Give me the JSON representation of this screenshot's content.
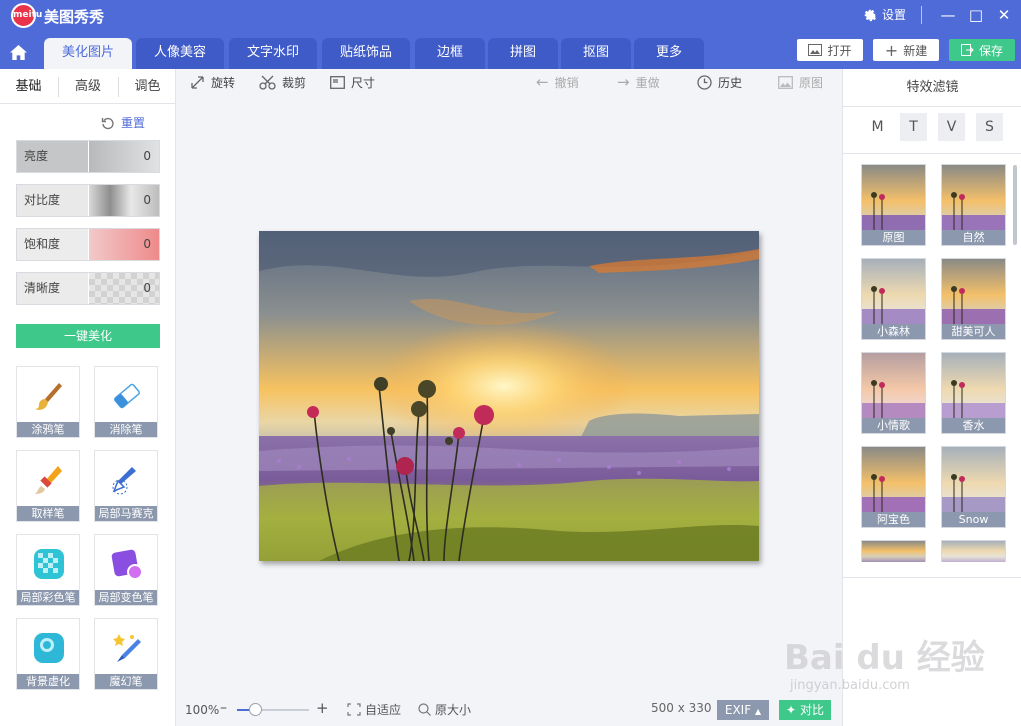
{
  "app": {
    "title": "美图秀秀",
    "logo_text": "meitu"
  },
  "window": {
    "settings_label": "设置"
  },
  "tabs": [
    {
      "label": "美化图片",
      "active": true
    },
    {
      "label": "人像美容"
    },
    {
      "label": "文字水印"
    },
    {
      "label": "贴纸饰品"
    },
    {
      "label": "边框"
    },
    {
      "label": "拼图"
    },
    {
      "label": "抠图"
    },
    {
      "label": "更多"
    }
  ],
  "actions": {
    "open": "打开",
    "new": "新建",
    "save": "保存"
  },
  "left": {
    "subtabs": [
      "基础",
      "高级",
      "调色"
    ],
    "reset_label": "重置",
    "sliders": [
      {
        "label": "亮度",
        "value": "0"
      },
      {
        "label": "对比度",
        "value": "0"
      },
      {
        "label": "饱和度",
        "value": "0"
      },
      {
        "label": "清晰度",
        "value": "0"
      }
    ],
    "one_key": "一键美化",
    "tools": [
      {
        "label": "涂鸦笔",
        "icon": "brush-icon"
      },
      {
        "label": "消除笔",
        "icon": "eraser-icon"
      },
      {
        "label": "取样笔",
        "icon": "sample-brush-icon"
      },
      {
        "label": "局部马赛克",
        "icon": "mosaic-pen-icon"
      },
      {
        "label": "局部彩色笔",
        "icon": "color-pen-icon"
      },
      {
        "label": "局部变色笔",
        "icon": "recolor-pen-icon"
      },
      {
        "label": "背景虚化",
        "icon": "blur-bg-icon"
      },
      {
        "label": "魔幻笔",
        "icon": "magic-pen-icon"
      }
    ]
  },
  "toolbar": {
    "rotate": "旋转",
    "crop": "裁剪",
    "size": "尺寸",
    "undo": "撤销",
    "redo": "重做",
    "history": "历史",
    "original": "原图"
  },
  "right": {
    "title": "特效滤镜",
    "filter_tabs": [
      "M",
      "T",
      "V",
      "S"
    ],
    "filters": [
      "原图",
      "自然",
      "小森林",
      "甜美可人",
      "小情歌",
      "香水",
      "阿宝色",
      "Snow"
    ]
  },
  "status": {
    "zoom": "100%",
    "fit": "自适应",
    "actual": "原大小",
    "dimensions": "500 x 330",
    "exif": "EXIF",
    "compare": "对比"
  },
  "watermark": {
    "brand": "Bai du 经验",
    "url": "jingyan.baidu.com"
  },
  "colors": {
    "primary": "#4f6bd8",
    "green": "#3ec98a",
    "label_gray": "#8c98ad"
  }
}
